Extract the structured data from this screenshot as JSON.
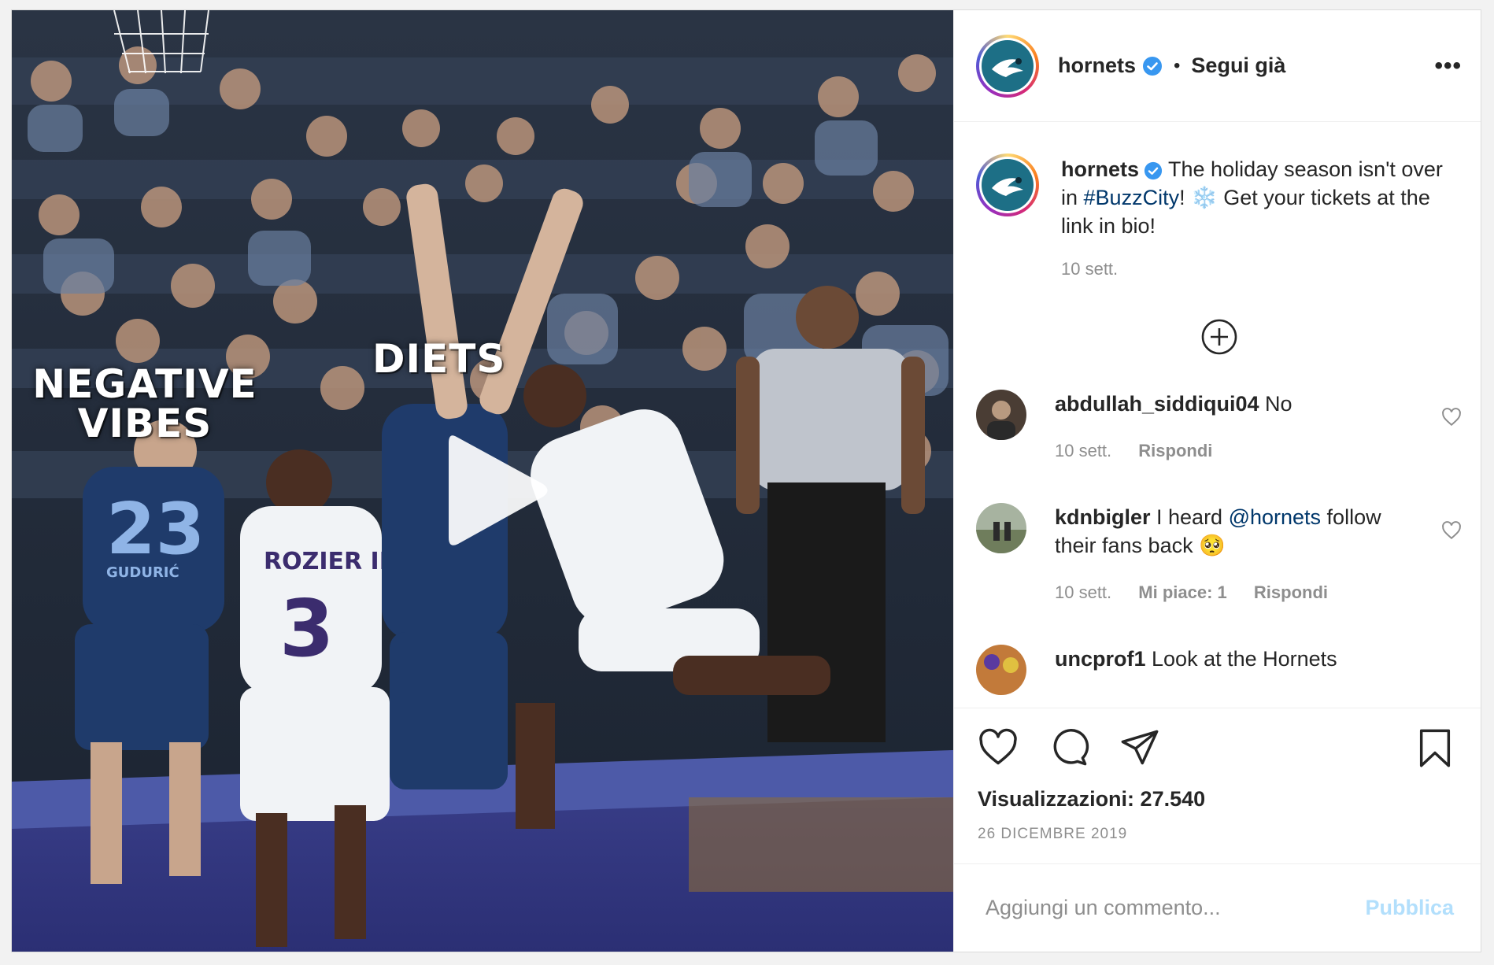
{
  "header": {
    "username": "hornets",
    "follow_state": "Segui già",
    "separator": "•",
    "more": "•••"
  },
  "media": {
    "overlay_left": "NEGATIVE\nVIBES",
    "overlay_left_line1": "NEGATIVE",
    "overlay_left_line2": "VIBES",
    "overlay_right": "DIETS",
    "jerseys": [
      {
        "number": "23",
        "name": "GUDURIĆ"
      },
      {
        "number": "3",
        "name": "ROZIER III"
      }
    ]
  },
  "caption": {
    "username": "hornets",
    "text_before": " The holiday season isn't over in ",
    "hashtag": "#BuzzCity",
    "text_middle": "! ",
    "emoji": "❄️",
    "text_after": " Get your tickets at the link in bio!",
    "time": "10 sett."
  },
  "comments": [
    {
      "username": "abdullah_siddiqui04",
      "text": " No",
      "time": "10 sett.",
      "likes": "",
      "reply": "Rispondi"
    },
    {
      "username": "kdnbigler",
      "text_before": " I heard ",
      "mention": "@hornets",
      "text_after": " follow their fans back ",
      "emoji": "🥺",
      "time": "10 sett.",
      "likes": "Mi piace: 1",
      "reply": "Rispondi"
    },
    {
      "username": "uncprof1",
      "text": " Look at the Hornets"
    }
  ],
  "stats": {
    "views_label": "Visualizzazioni: 27.540",
    "date": "26 DICEMBRE 2019"
  },
  "composer": {
    "placeholder": "Aggiungi un commento...",
    "publish": "Pubblica"
  },
  "colors": {
    "link": "#00376b",
    "publish_disabled": "#b2dffc",
    "muted": "#8e8e8e",
    "verified": "#3897f0"
  }
}
